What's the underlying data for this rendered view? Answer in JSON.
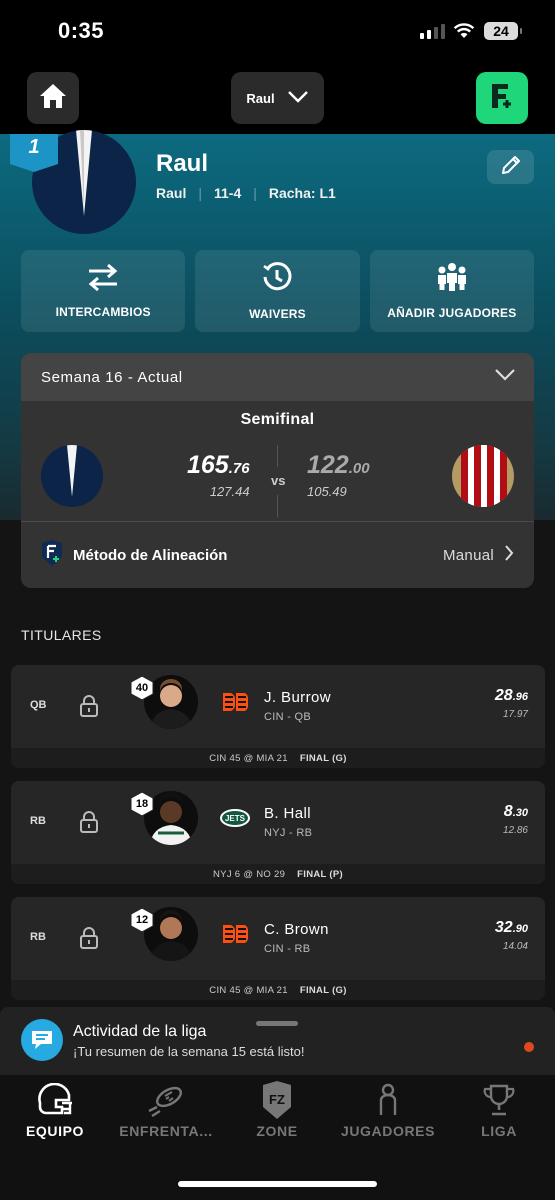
{
  "status_bar": {
    "time": "0:35",
    "battery": "24"
  },
  "header": {
    "team_selector": "Raul"
  },
  "profile": {
    "rank": "1",
    "team_name": "Raul",
    "owner": "Raul",
    "record": "11-4",
    "streak": "Racha: L1"
  },
  "actions": [
    {
      "label": "INTERCAMBIOS",
      "icon": "swap-arrows-icon"
    },
    {
      "label": "WAIVERS",
      "icon": "clock-waivers-icon"
    },
    {
      "label": "AÑADIR JUGADORES",
      "icon": "add-players-icon"
    }
  ],
  "week": {
    "selector": "Semana 16 - Actual",
    "round": "Semifinal",
    "home": {
      "score_int": "165",
      "score_dec": ".76",
      "projected": "127.44"
    },
    "away": {
      "score_int": "122",
      "score_dec": ".00",
      "projected": "105.49"
    },
    "vs": "vs",
    "method_label": "Método de Alineación",
    "method_value": "Manual"
  },
  "lineup": {
    "title": "TITULARES",
    "players": [
      {
        "pos": "QB",
        "number": "40",
        "name": "J. Burrow",
        "team_pos": "CIN - QB",
        "team_logo": "bengals-logo",
        "pts_int": "28",
        "pts_dec": ".96",
        "projected": "17.97",
        "game": "CIN 45 @ MIA 21",
        "game_status": "FINAL (G)"
      },
      {
        "pos": "RB",
        "number": "18",
        "name": "B. Hall",
        "team_pos": "NYJ - RB",
        "team_logo": "jets-logo",
        "pts_int": "8",
        "pts_dec": ".30",
        "projected": "12.86",
        "game": "NYJ 6 @ NO 29",
        "game_status": "FINAL (P)"
      },
      {
        "pos": "RB",
        "number": "12",
        "name": "C. Brown",
        "team_pos": "CIN - RB",
        "team_logo": "bengals-logo",
        "pts_int": "32",
        "pts_dec": ".90",
        "projected": "14.04",
        "game": "CIN 45 @ MIA 21",
        "game_status": "FINAL (G)"
      }
    ]
  },
  "activity": {
    "title": "Actividad de la liga",
    "subtitle": "¡Tu resumen de la semana 15 está listo!"
  },
  "nav": [
    {
      "label": "EQUIPO",
      "icon": "helmet-icon",
      "active": true
    },
    {
      "label": "ENFRENTA...",
      "icon": "football-icon",
      "active": false
    },
    {
      "label": "ZONE",
      "icon": "fz-shield-icon",
      "active": false
    },
    {
      "label": "JUGADORES",
      "icon": "player-icon",
      "active": false
    },
    {
      "label": "LIGA",
      "icon": "trophy-icon",
      "active": false
    }
  ],
  "colors": {
    "accent_green": "#1fd67a",
    "teal": "#0d6a80",
    "activity_blue": "#27a9e1",
    "notification_dot": "#e0491f"
  }
}
